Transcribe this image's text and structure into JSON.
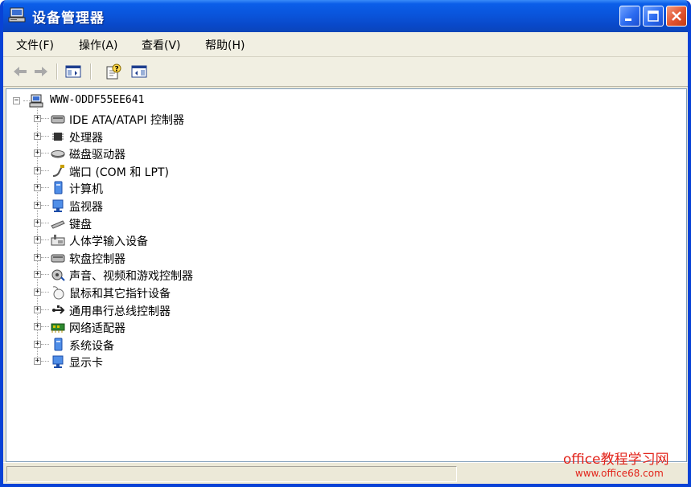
{
  "window": {
    "title": "设备管理器"
  },
  "menu": [
    {
      "label": "文件(F)"
    },
    {
      "label": "操作(A)"
    },
    {
      "label": "查看(V)"
    },
    {
      "label": "帮助(H)"
    }
  ],
  "tree": {
    "root": {
      "label": "WWW-ODDF55EE641",
      "expander": "−",
      "icon": "computer-icon"
    },
    "children": [
      {
        "label": "IDE ATA/ATAPI 控制器",
        "icon": "ide-controller-icon",
        "expander": "+"
      },
      {
        "label": "处理器",
        "icon": "processor-icon",
        "expander": "+"
      },
      {
        "label": "磁盘驱动器",
        "icon": "disk-drive-icon",
        "expander": "+"
      },
      {
        "label": "端口 (COM 和 LPT)",
        "icon": "port-icon",
        "expander": "+"
      },
      {
        "label": "计算机",
        "icon": "computer-icon",
        "expander": "+"
      },
      {
        "label": "监视器",
        "icon": "monitor-icon",
        "expander": "+"
      },
      {
        "label": "键盘",
        "icon": "keyboard-icon",
        "expander": "+"
      },
      {
        "label": "人体学输入设备",
        "icon": "hid-icon",
        "expander": "+"
      },
      {
        "label": "软盘控制器",
        "icon": "floppy-controller-icon",
        "expander": "+"
      },
      {
        "label": "声音、视频和游戏控制器",
        "icon": "sound-icon",
        "expander": "+"
      },
      {
        "label": "鼠标和其它指针设备",
        "icon": "mouse-icon",
        "expander": "+"
      },
      {
        "label": "通用串行总线控制器",
        "icon": "usb-icon",
        "expander": "+"
      },
      {
        "label": "网络适配器",
        "icon": "network-adapter-icon",
        "expander": "+"
      },
      {
        "label": "系统设备",
        "icon": "system-device-icon",
        "expander": "+"
      },
      {
        "label": "显示卡",
        "icon": "display-adapter-icon",
        "expander": "+"
      }
    ]
  },
  "watermark": {
    "line1": "office教程学习网",
    "line2": "www.office68.com"
  },
  "colors": {
    "titlebar": "#0a55dc",
    "frame": "#0842d6",
    "watermark": "#e2231a"
  }
}
